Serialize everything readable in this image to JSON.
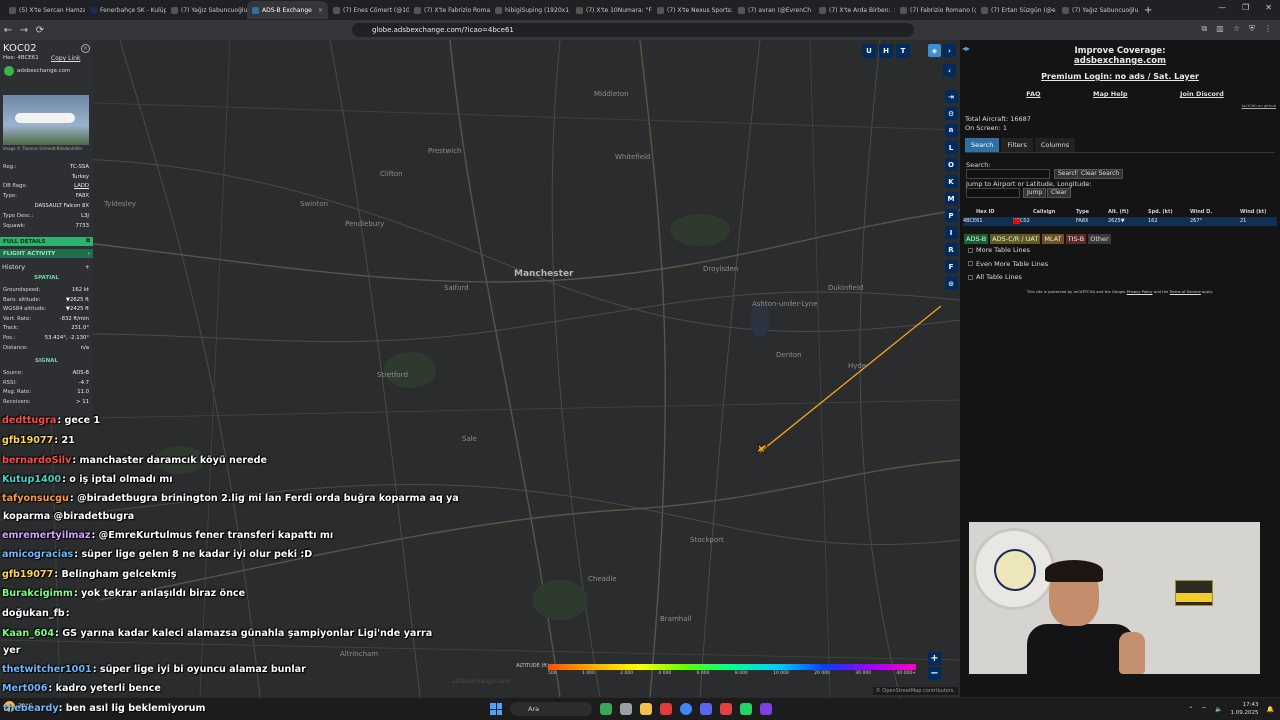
{
  "browser": {
    "tabs": [
      {
        "label": "(5) X'te Sercan Hamzaoğlu",
        "active": false
      },
      {
        "label": "Fenerbahçe SK - Kulüp",
        "active": false
      },
      {
        "label": "(7) Yağız Sabuncuoğlu",
        "active": false
      },
      {
        "label": "ADS-B Exchange",
        "active": true
      },
      {
        "label": "(7) Enes Cömert (@10",
        "active": false
      },
      {
        "label": "(7) X'te Fabrizio Romano",
        "active": false
      },
      {
        "label": "hibigiSuping (1920x1",
        "active": false
      },
      {
        "label": "(7) X'te 10Numara: \"F",
        "active": false
      },
      {
        "label": "(7) X'te Nexus Sports:",
        "active": false
      },
      {
        "label": "(7) avran (@EvrenCh",
        "active": false
      },
      {
        "label": "(7) X'te Arda Birben:",
        "active": false
      },
      {
        "label": "(7) Fabrizio Romano (@",
        "active": false
      },
      {
        "label": "(7) Ertan Süzgün (@e",
        "active": false
      },
      {
        "label": "(7) Yağız Sabuncuoğlu",
        "active": false
      }
    ],
    "url": "globe.adsbexchange.com/?icao=4bce61"
  },
  "map": {
    "places": [
      {
        "name": "Middleton",
        "big": false
      },
      {
        "name": "Prestwich",
        "big": false
      },
      {
        "name": "Clifton",
        "big": false
      },
      {
        "name": "Whitefield",
        "big": false
      },
      {
        "name": "Tyldesley",
        "big": false
      },
      {
        "name": "Swinton",
        "big": false
      },
      {
        "name": "Pendlebury",
        "big": false
      },
      {
        "name": "Salford",
        "big": false
      },
      {
        "name": "Manchester",
        "big": true
      },
      {
        "name": "Droylsden",
        "big": false
      },
      {
        "name": "Ashton-under-Lyne",
        "big": false
      },
      {
        "name": "Dukinfield",
        "big": false
      },
      {
        "name": "Stretford",
        "big": false
      },
      {
        "name": "Sale",
        "big": false
      },
      {
        "name": "Denton",
        "big": false
      },
      {
        "name": "Stockport",
        "big": false
      },
      {
        "name": "Cheadle",
        "big": false
      },
      {
        "name": "Bramhall",
        "big": false
      },
      {
        "name": "Altrincham",
        "big": false
      },
      {
        "name": "Hyde",
        "big": false
      }
    ],
    "altitude_label": "ALTITUDE (ft)",
    "altitude_ticks": [
      "500",
      "1 000",
      "2 000",
      "4 000",
      "6 000",
      "8 000",
      "10 000",
      "20 000",
      "30 000",
      "40 000+"
    ],
    "watermark": "adsbexchange.com",
    "attribution": "© OpenStreetMap contributors.",
    "top_buttons": [
      "U",
      "H",
      "T"
    ],
    "side_buttons": [
      "L",
      "O",
      "K",
      "M",
      "P",
      "I",
      "R",
      "F"
    ]
  },
  "aircraft": {
    "callsign": "KOC02",
    "hex_line": "Hex: 4BCE61",
    "copy_link": "Copy Link",
    "source_site": "adsbexchange.com",
    "photo_credit": "Image © Thomas Schmidt-Blindenhöfer",
    "reg_label": "Reg.:",
    "reg": "TC-SSA",
    "country": "Turkey",
    "dbflags_label": "DB flags:",
    "dbflags": "LADD",
    "type_label": "Type:",
    "type": "FA8X",
    "type_name": "DASSAULT Falcon 8X",
    "typedesc_label": "Type Desc.:",
    "typedesc": "L3J",
    "squawk_label": "Squawk:",
    "squawk": "7733",
    "full_details": "FULL DETAILS",
    "flight_activity": "FLIGHT ACTIVITY",
    "history": "History",
    "spatial": "SPATIAL",
    "spatial_rows": [
      {
        "k": "Groundspeed:",
        "v": "162 kt"
      },
      {
        "k": "Baro. altitude:",
        "v": "▼2625 ft"
      },
      {
        "k": "WGS84 altitude:",
        "v": "▼2425 ft"
      },
      {
        "k": "Vert. Rate:",
        "v": "-832 ft/min"
      },
      {
        "k": "Track:",
        "v": "231.0°"
      },
      {
        "k": "Pos.:",
        "v": "53.424°, -2.130°"
      },
      {
        "k": "Distance:",
        "v": "n/a"
      }
    ],
    "signal": "SIGNAL",
    "signal_rows": [
      {
        "k": "Source:",
        "v": "ADS-B"
      },
      {
        "k": "RSSI:",
        "v": "-4.7"
      },
      {
        "k": "Msg. Rate:",
        "v": "11.0"
      },
      {
        "k": "Receivers:",
        "v": "> 11"
      }
    ]
  },
  "chat": [
    {
      "user": "dedttugra",
      "color": "#ff4b4b",
      "text": ": gece 1"
    },
    {
      "user": "gfb19077",
      "color": "#ffd84a",
      "text": ": 21"
    },
    {
      "user": "bernardoSilv",
      "color": "#ff4b4b",
      "text": ": manchaster daramcık köyü nerede"
    },
    {
      "user": "Kutup1400",
      "color": "#3fd6c8",
      "text": ": o iş iptal olmadı mı"
    },
    {
      "user": "tafyonsucgu",
      "color": "#ff9a3c",
      "text": ": @biradetbugra brinington 2.lig mi lan Ferdi orda buğra koparma aq ya"
    },
    {
      "user": "",
      "color": "#ffffff",
      "text": "koparma @biradetbugra"
    },
    {
      "user": "emremertyilmaz",
      "color": "#d6a0ff",
      "text": ": @EmreKurtulmus fener transferi kapattı mı"
    },
    {
      "user": "amicogracias",
      "color": "#6fb7ff",
      "text": ": süper lige gelen 8 ne kadar iyi olur peki :D"
    },
    {
      "user": "gfb19077",
      "color": "#ffd84a",
      "text": ": Belingham gelcekmiş"
    },
    {
      "user": "Burakcigimm",
      "color": "#7dff7d",
      "text": ": yok tekrar anlaşıldı biraz önce"
    },
    {
      "user": "doğukan_fb",
      "color": "#ffffff",
      "text": ":"
    },
    {
      "user": "Kaan_604",
      "color": "#7dff7d",
      "text": ": GS yarına kadar kaleci alamazsa günahla şampiyonlar Ligi'nde yarra"
    },
    {
      "user": "",
      "color": "#ffffff",
      "text": "yer"
    },
    {
      "user": "thetwitcher1001",
      "color": "#6fb7ff",
      "text": ": süper lige iyi bi oyuncu alamaz bunlar"
    },
    {
      "user": "Mert006",
      "color": "#6fb7ff",
      "text": ": kadro yeterli bence"
    }
  ],
  "sidebar": {
    "improve_line1": "Improve Coverage:",
    "improve_line2": "adsbexchange.com",
    "premium": "Premium Login: no ads / Sat. Layer",
    "links": [
      "FAQ",
      "Map Help",
      "Join Discord"
    ],
    "tiny_link": "tar1090 on github",
    "total_label": "Total Aircraft:",
    "total": "16687",
    "onscreen_label": "On Screen:",
    "onscreen": "1",
    "tabs": [
      "Search",
      "Filters",
      "Columns"
    ],
    "search_label": "Search:",
    "search_button": "Search",
    "clear_search_button": "Clear Search",
    "jump_label": "Jump to Airport or Latitude, Longitude:",
    "jump_button": "Jump",
    "clear_button": "Clear",
    "table_headers": [
      "Hex ID",
      "Callsign",
      "Type",
      "Alt. (ft)",
      "Spd. (kt)",
      "Wind D.",
      "Wind (kt)"
    ],
    "table_row": [
      "4BCE61",
      "KOC02",
      "FA8X",
      "2625▼",
      "162",
      "267°",
      "21"
    ],
    "legend": [
      "ADS-B",
      "ADS-C/R / UAT",
      "MLAT",
      "TIS-B",
      "Other"
    ],
    "checkboxes": [
      "More Table Lines",
      "Even More Table Lines",
      "All Table Lines"
    ],
    "recaptcha_pre": "This site is protected by reCAPTCHA and the Google ",
    "recaptcha_privacy": "Privacy Policy",
    "recaptcha_and": " and the ",
    "recaptcha_terms": "Terms of Service",
    "recaptcha_post": " apply."
  },
  "taskbar": {
    "weather": "32°C",
    "search_placeholder": "Ara",
    "time": "17:43",
    "date": "1.09.2025",
    "bottom_chat_user": "thebeardy",
    "bottom_chat_text": ": ben asıl lig beklemiyorum"
  }
}
